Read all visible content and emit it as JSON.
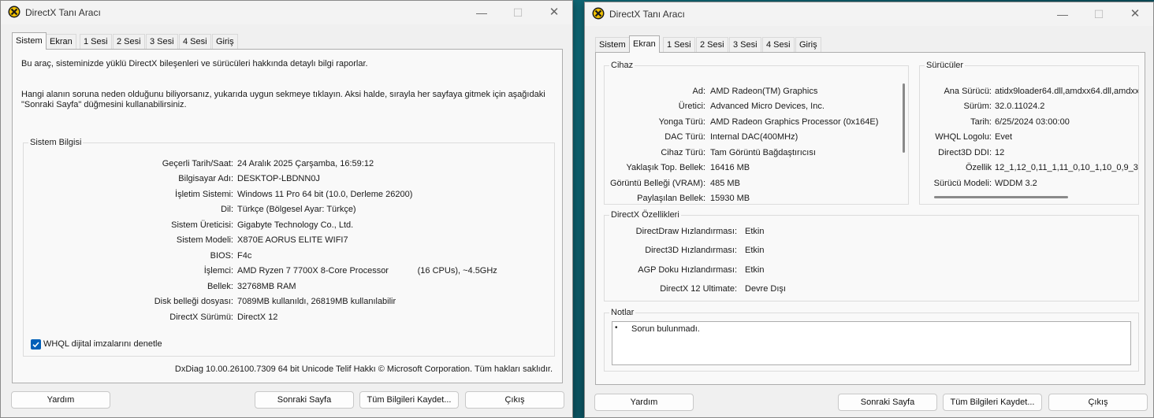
{
  "colors": {
    "accent": "#005fb8",
    "window_bg": "#f0f0f0",
    "panel_bg": "#f9f9f9"
  },
  "left": {
    "title": "DirectX Tanı Aracı",
    "tabs": [
      "Sistem",
      "Ekran",
      "1 Sesi",
      "2 Sesi",
      "3 Sesi",
      "4 Sesi",
      "Giriş"
    ],
    "active_tab": "Sistem",
    "intro1": "Bu araç, sisteminizde yüklü DirectX bileşenleri ve sürücüleri hakkında detaylı bilgi raporlar.",
    "intro2a": "Hangi alanın soruna neden olduğunu biliyorsanız, yukarıda uygun sekmeye tıklayın. Aksi halde, sırayla her sayfaya gitmek için aşağıdaki",
    "intro2b": "\"Sonraki Sayfa\" düğmesini kullanabilirsiniz.",
    "system_info": {
      "title": "Sistem Bilgisi",
      "rows": [
        {
          "k": "Geçerli Tarih/Saat:",
          "v": "24 Aralık 2025 Çarşamba, 16:59:12"
        },
        {
          "k": "Bilgisayar Adı:",
          "v": "DESKTOP-LBDNN0J"
        },
        {
          "k": "İşletim Sistemi:",
          "v": "Windows 11 Pro 64 bit (10.0, Derleme 26200)"
        },
        {
          "k": "Dil:",
          "v": "Türkçe (Bölgesel Ayar: Türkçe)"
        },
        {
          "k": "Sistem Üreticisi:",
          "v": "Gigabyte Technology Co., Ltd."
        },
        {
          "k": "Sistem Modeli:",
          "v": "X870E AORUS ELITE WIFI7"
        },
        {
          "k": "BIOS:",
          "v": "F4c"
        },
        {
          "k": "İşlemci:",
          "v": "AMD Ryzen 7 7700X 8-Core Processor            (16 CPUs), ~4.5GHz"
        },
        {
          "k": "Bellek:",
          "v": "32768MB RAM"
        },
        {
          "k": "Disk belleği dosyası:",
          "v": "7089MB kullanıldı, 26819MB kullanılabilir"
        },
        {
          "k": "DirectX Sürümü:",
          "v": "DirectX 12"
        }
      ],
      "whql_label": "WHQL dijital imzalarını denetle"
    },
    "footer": "DxDiag 10.00.26100.7309 64 bit Unicode  Telif Hakkı © Microsoft Corporation. Tüm hakları saklıdır.",
    "buttons": {
      "help": "Yardım",
      "next": "Sonraki Sayfa",
      "save": "Tüm Bilgileri Kaydet...",
      "exit": "Çıkış"
    }
  },
  "right": {
    "title": "DirectX Tanı Aracı",
    "tabs": [
      "Sistem",
      "Ekran",
      "1 Sesi",
      "2 Sesi",
      "3 Sesi",
      "4 Sesi",
      "Giriş"
    ],
    "active_tab": "Ekran",
    "device": {
      "title": "Cihaz",
      "rows": [
        {
          "k": "Ad:",
          "v": "AMD Radeon(TM) Graphics"
        },
        {
          "k": "Üretici:",
          "v": "Advanced Micro Devices, Inc."
        },
        {
          "k": "Yonga Türü:",
          "v": "AMD Radeon Graphics Processor (0x164E)"
        },
        {
          "k": "DAC Türü:",
          "v": "Internal DAC(400MHz)"
        },
        {
          "k": "Cihaz Türü:",
          "v": "Tam Görüntü Bağdaştırıcısı"
        },
        {
          "k": "Yaklaşık Top. Bellek:",
          "v": "16416 MB"
        },
        {
          "k": "Görüntü Belleği (VRAM):",
          "v": "485 MB"
        },
        {
          "k": "Paylaşılan Bellek:",
          "v": "15930 MB"
        }
      ]
    },
    "drivers": {
      "title": "Sürücüler",
      "rows": [
        {
          "k": "Ana Sürücü:",
          "v": "atidx9loader64.dll,amdxx64.dll,amdxx"
        },
        {
          "k": "Sürüm:",
          "v": "32.0.11024.2"
        },
        {
          "k": "Tarih:",
          "v": "6/25/2024 03:00:00"
        },
        {
          "k": "WHQL Logolu:",
          "v": "Evet"
        },
        {
          "k": "Direct3D DDI:",
          "v": "12"
        },
        {
          "k": "Özellik",
          "v": "12_1,12_0,11_1,11_0,10_1,10_0,9_3"
        },
        {
          "k": "Sürücü Modeli:",
          "v": "WDDM 3.2"
        }
      ]
    },
    "features": {
      "title": "DirectX Özellikleri",
      "rows": [
        {
          "k": "DirectDraw Hızlandırması:",
          "v": "Etkin"
        },
        {
          "k": "Direct3D Hızlandırması:",
          "v": "Etkin"
        },
        {
          "k": "AGP Doku Hızlandırması:",
          "v": "Etkin"
        },
        {
          "k": "DirectX 12 Ultimate:",
          "v": "Devre Dışı"
        }
      ]
    },
    "notes": {
      "title": "Notlar",
      "items": [
        "Sorun bulunmadı."
      ]
    },
    "buttons": {
      "help": "Yardım",
      "next": "Sonraki Sayfa",
      "save": "Tüm Bilgileri Kaydet...",
      "exit": "Çıkış"
    }
  }
}
